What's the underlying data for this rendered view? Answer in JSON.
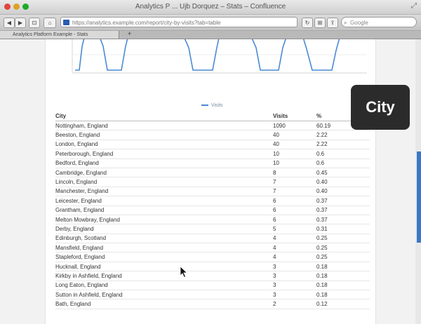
{
  "window": {
    "title": "Analytics P ... Ujb Dorquez – Stats – Confluence",
    "resize_icon": "resize-icon"
  },
  "toolbar": {
    "back_label": "◀",
    "forward_label": "▶",
    "reader_label": "⊡",
    "url": "https://analytics.example.com/report/city-by-visits?tab=table",
    "reload_label": "↻",
    "bookmark_label": "⊞",
    "search_placeholder": "Google"
  },
  "tab": {
    "label": "Analytics Platform Example - Stats",
    "add_label": "+"
  },
  "chart_data": {
    "type": "line",
    "series": [
      {
        "name": "Visits",
        "color": "#4a8ad4"
      }
    ],
    "x_tick_labels": [
      "",
      "",
      "",
      ""
    ],
    "legend": "bottom-center"
  },
  "table": {
    "headers": [
      "City",
      "Visits",
      "%"
    ],
    "rows": [
      [
        "Nottingham, England",
        "1090",
        "60.19"
      ],
      [
        "Beeston, England",
        "40",
        "2.22"
      ],
      [
        "London, England",
        "40",
        "2.22"
      ],
      [
        "Peterborough, England",
        "10",
        "0.6"
      ],
      [
        "Bedford, England",
        "10",
        "0.6"
      ],
      [
        "Cambridge, England",
        "8",
        "0.45"
      ],
      [
        "Lincoln, England",
        "7",
        "0.40"
      ],
      [
        "Manchester, England",
        "7",
        "0.40"
      ],
      [
        "Leicester, England",
        "6",
        "0.37"
      ],
      [
        "Grantham, England",
        "6",
        "0.37"
      ],
      [
        "Melton Mowbray, England",
        "6",
        "0.37"
      ],
      [
        "Derby, England",
        "5",
        "0.31"
      ],
      [
        "Edinburgh, Scotland",
        "4",
        "0.25"
      ],
      [
        "Mansfield, England",
        "4",
        "0.25"
      ],
      [
        "Stapleford, England",
        "4",
        "0.25"
      ],
      [
        "Hucknall, England",
        "3",
        "0.18"
      ],
      [
        "Kirkby in Ashfield, England",
        "3",
        "0.18"
      ],
      [
        "Long Eaton, England",
        "3",
        "0.18"
      ],
      [
        "Sutton in Ashfield, England",
        "3",
        "0.18"
      ],
      [
        "Bath, England",
        "2",
        "0.12"
      ]
    ]
  },
  "overlay": {
    "label": "City"
  },
  "colors": {
    "accent": "#3b78c6",
    "series": "#4a8ad4",
    "overlay_bg": "#2b2b2b"
  }
}
